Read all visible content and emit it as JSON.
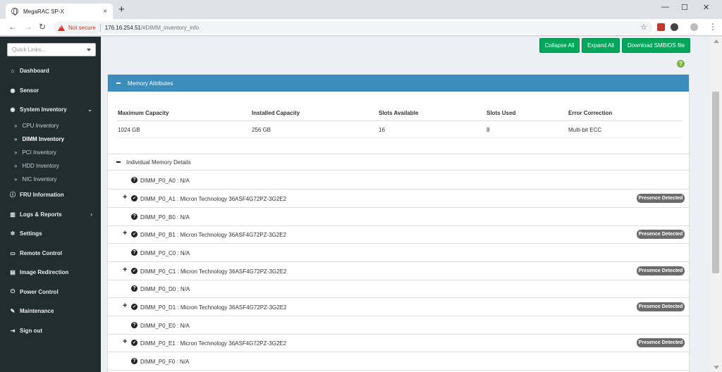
{
  "browser": {
    "tab_title": "MegaRAC SP-X",
    "tab_close": "×",
    "new_tab": "+",
    "win_min": "—",
    "win_max": "☐",
    "win_close": "✕",
    "back": "←",
    "forward": "→",
    "reload": "↻",
    "not_secure": "Not secure",
    "url_host": "176.16.254.51",
    "url_path": "/#DIMM_inventory_info",
    "star": "☆",
    "menu": "⋮"
  },
  "sidebar": {
    "quick_links_placeholder": "Quick Links...",
    "items": [
      {
        "label": "Dashboard",
        "icon": "home-icon"
      },
      {
        "label": "Sensor",
        "icon": "sensor-icon"
      },
      {
        "label": "System Inventory",
        "icon": "inventory-icon"
      },
      {
        "label": "FRU Information",
        "icon": "info-icon"
      },
      {
        "label": "Logs & Reports",
        "icon": "chart-icon"
      },
      {
        "label": "Settings",
        "icon": "gear-icon"
      },
      {
        "label": "Remote Control",
        "icon": "monitor-icon"
      },
      {
        "label": "Image Redirection",
        "icon": "disk-icon"
      },
      {
        "label": "Power Control",
        "icon": "power-icon"
      },
      {
        "label": "Maintenance",
        "icon": "wrench-icon"
      },
      {
        "label": "Sign out",
        "icon": "signout-icon"
      }
    ],
    "sub_items": [
      {
        "label": "CPU Inventory"
      },
      {
        "label": "DIMM Inventory"
      },
      {
        "label": "PCI Inventory"
      },
      {
        "label": "HDD Inventory"
      },
      {
        "label": "NIC Inventory"
      }
    ]
  },
  "toolbar": {
    "collapse_all": "Collapse All",
    "expand_all": "Expand All",
    "download_smbios": "Download SMBIOS file",
    "help": "?"
  },
  "memory_attributes": {
    "title": "Memory Attributes",
    "headers": [
      "Maximum Capacity",
      "Installed Capacity",
      "Slots Available",
      "Slots Used",
      "Error Correction"
    ],
    "values": [
      "1024 GB",
      "256 GB",
      "16",
      "8",
      "Multi-bit ECC"
    ]
  },
  "details": {
    "title": "Individual Memory Details",
    "rows": [
      {
        "label": "DIMM_P0_A0 : N/A",
        "present": false
      },
      {
        "label": "DIMM_P0_A1 : Micron Technology 36ASF4G72PZ-3G2E2",
        "present": true
      },
      {
        "label": "DIMM_P0_B0 : N/A",
        "present": false
      },
      {
        "label": "DIMM_P0_B1 : Micron Technology 36ASF4G72PZ-3G2E2",
        "present": true
      },
      {
        "label": "DIMM_P0_C0 : N/A",
        "present": false
      },
      {
        "label": "DIMM_P0_C1 : Micron Technology 36ASF4G72PZ-3G2E2",
        "present": true
      },
      {
        "label": "DIMM_P0_D0 : N/A",
        "present": false
      },
      {
        "label": "DIMM_P0_D1 : Micron Technology 36ASF4G72PZ-3G2E2",
        "present": true
      },
      {
        "label": "DIMM_P0_E0 : N/A",
        "present": false
      },
      {
        "label": "DIMM_P0_E1 : Micron Technology 36ASF4G72PZ-3G2E2",
        "present": true
      },
      {
        "label": "DIMM_P0_F0 : N/A",
        "present": false
      }
    ],
    "badge": "Presence Detected"
  }
}
